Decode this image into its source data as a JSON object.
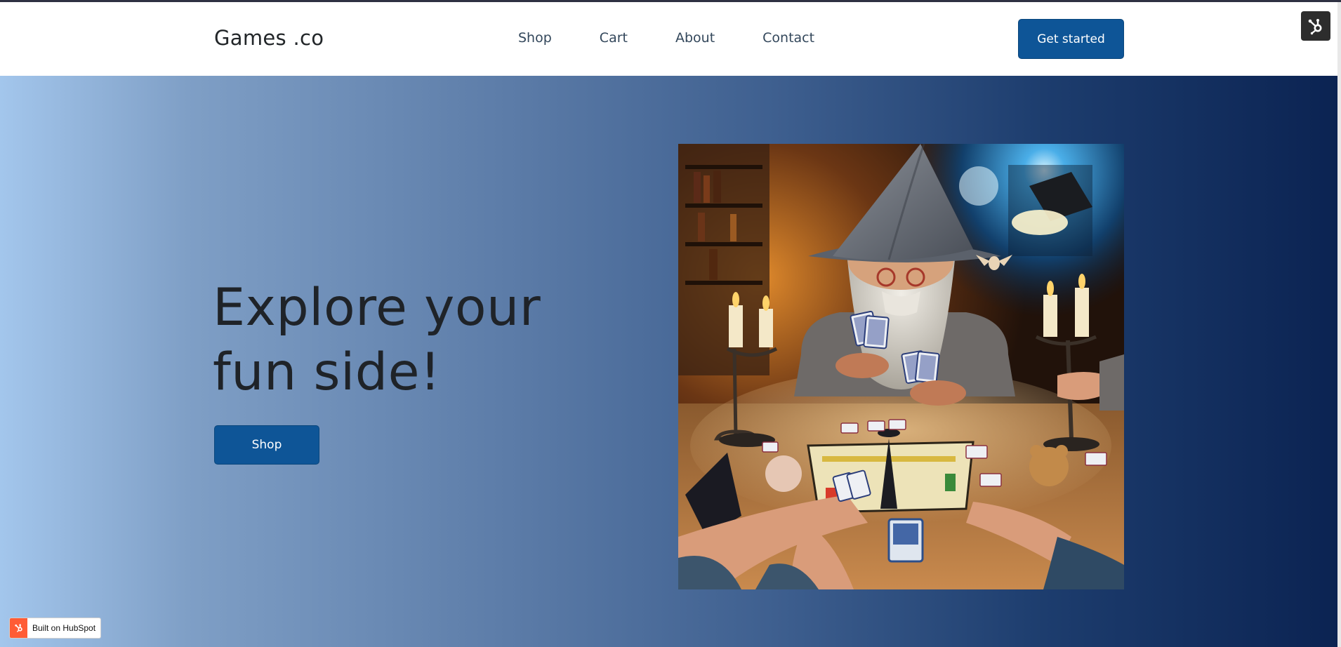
{
  "header": {
    "logo": "Games .co",
    "nav": [
      {
        "label": "Shop"
      },
      {
        "label": "Cart"
      },
      {
        "label": "About"
      },
      {
        "label": "Contact"
      }
    ],
    "cta_label": "Get started"
  },
  "hero": {
    "headline_line1": "Explore your",
    "headline_line2": "fun side!",
    "button_label": "Shop",
    "image_icon": "wizard-card-game-illustration"
  },
  "badge": {
    "label": "Built on HubSpot",
    "icon": "hubspot-sprocket-icon"
  },
  "tool_icon": "hubspot-sprocket-icon",
  "colors": {
    "primary": "#0e5597",
    "text": "#222629",
    "nav_text": "#33475b",
    "hubspot_orange": "#ff5c35",
    "gradient_start": "#a3c6ec",
    "gradient_end": "#0b2352"
  }
}
